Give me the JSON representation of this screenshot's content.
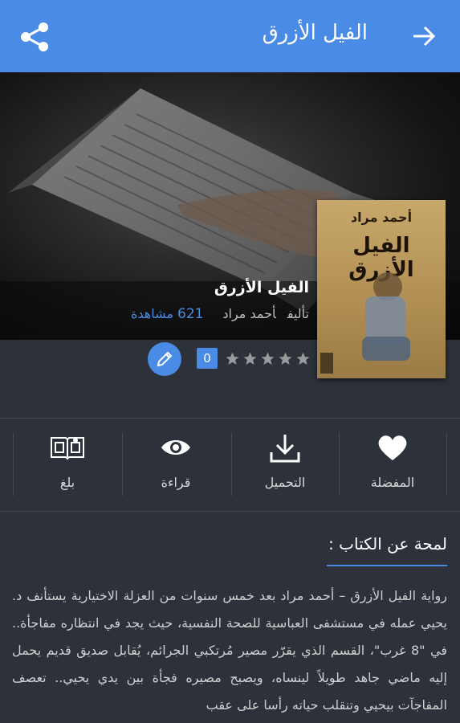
{
  "appbar": {
    "title": "الفيل الأزرق",
    "back_icon": "arrow-right-icon",
    "share_icon": "share-icon",
    "color": "#4a8be5"
  },
  "book": {
    "cover_author": "أحمد مراد",
    "cover_title": "الفيل الأزرق",
    "title": "الفيل الأزرق",
    "author_label": "تأليف",
    "author": "أحمد مراد",
    "views_count": "621",
    "views_label": "مشاهدة",
    "rating_stars": 0,
    "rating_max": 5,
    "rating_count": "0"
  },
  "actions": [
    {
      "label": "المفضلة",
      "icon": "heart-icon"
    },
    {
      "label": "التحميل",
      "icon": "download-icon"
    },
    {
      "label": "قراءة",
      "icon": "eye-icon"
    },
    {
      "label": "بلغ",
      "icon": "book-report-icon"
    }
  ],
  "about": {
    "title": "لمحة عن الكتاب :",
    "text": "رواية الفيل الأزرق – أحمد مراد بعد خمس سنوات من العزلة الاختيارية يستأنف د. يحيي عمله في مستشفى العباسية للصحة النفسية، حيث يجد في انتظاره مفاجأة.. في \"8 غرب\"، القسم الذي يقرّر مصير مُرتكبي الجرائم، يُقابل صديق قديم يحمل إليه ماضي جاهد طويلاً لينساه، ويصبح مصيره فجأة بين يدي يحيي.. تعصف المفاجآت بيحيي وتنقلب حياته رأسا على عقب"
  }
}
